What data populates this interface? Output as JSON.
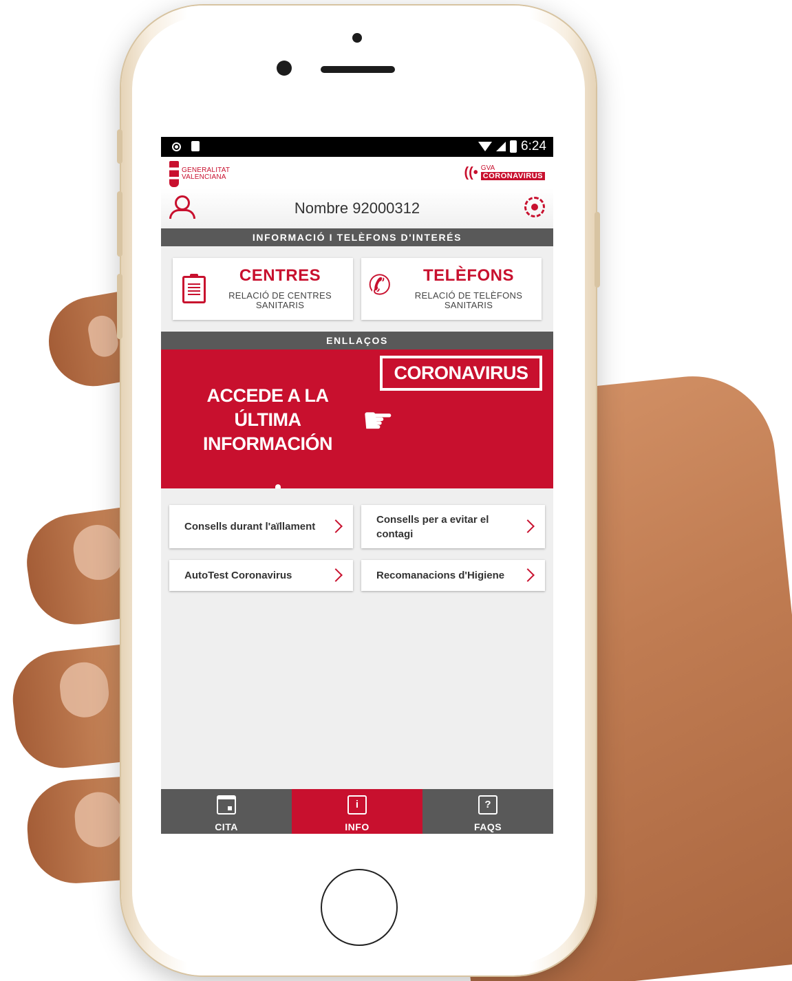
{
  "status_bar": {
    "time": "6:24"
  },
  "brand": {
    "left_logo": [
      "GENERALITAT",
      "VALENCIANA"
    ],
    "right_logo_top": "GVA",
    "right_logo_bottom": "CORONAVIRUS"
  },
  "user": {
    "name": "Nombre 92000312"
  },
  "sections": {
    "info_header": "INFORMACIÓ I TELÈFONS D'INTERÉS",
    "links_header": "ENLLAÇOS"
  },
  "cards": [
    {
      "title": "CENTRES",
      "subtitle": "RELACIÓ DE CENTRES SANITARIS",
      "icon": "clipboard-icon"
    },
    {
      "title": "TELÈFONS",
      "subtitle": "RELACIÓ DE TELÈFONS SANITARIS",
      "icon": "phone-icon"
    }
  ],
  "banner": {
    "lines": [
      "ACCEDE A LA",
      "ÚLTIMA",
      "INFORMACIÓN"
    ],
    "box_label": "CORONAVIRUS",
    "icon": "hand-pointer-icon"
  },
  "links": [
    {
      "label": "Consells durant l'aïllament"
    },
    {
      "label": "Consells per a evitar el contagi"
    },
    {
      "label": "AutoTest Coronavirus"
    },
    {
      "label": "Recomanacions d'Higiene"
    }
  ],
  "tabs": [
    {
      "label": "CITA",
      "icon": "calendar-icon",
      "active": false
    },
    {
      "label": "INFO",
      "icon": "info-icon",
      "active": true
    },
    {
      "label": "FAQS",
      "icon": "question-icon",
      "active": false
    }
  ],
  "colors": {
    "accent": "#c8102e",
    "header_gray": "#595959",
    "background": "#efefef"
  }
}
